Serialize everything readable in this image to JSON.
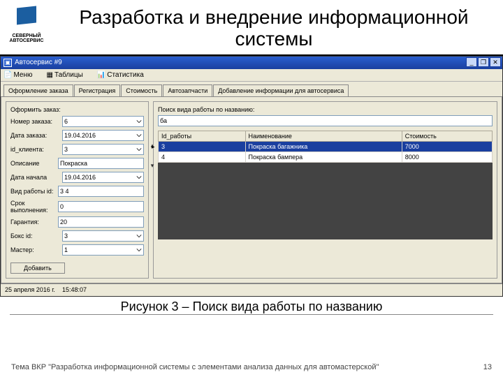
{
  "slide": {
    "title": "Разработка и внедрение информационной системы",
    "logo_caption": "СЕВЕРНЫЙ АВТОСЕРВИС"
  },
  "window": {
    "title": "Автосервис #9",
    "minimize": "_",
    "restore": "❐",
    "close": "✕"
  },
  "menu": {
    "items": [
      "Меню",
      "Таблицы",
      "Статистика"
    ]
  },
  "tabs": {
    "items": [
      "Оформление заказа",
      "Регистрация",
      "Стоимость",
      "Автозапчасти",
      "Добавление информации для автосервиса"
    ],
    "active_index": 0
  },
  "form": {
    "legend": "Оформить заказ:",
    "rows": [
      {
        "label": "Номер заказа:",
        "value": "6",
        "type": "select"
      },
      {
        "label": "Дата заказа:",
        "value": "19.04.2016",
        "type": "select"
      },
      {
        "label": "id_клиента:",
        "value": "3",
        "type": "select"
      },
      {
        "label": "Описание",
        "value": "Покраска",
        "type": "text"
      },
      {
        "label": "Дата начала",
        "value": "19.04.2016",
        "type": "select"
      },
      {
        "label": "Вид работы id:",
        "value": "3 4",
        "type": "text"
      },
      {
        "label": "Срок выполнения:",
        "value": "0",
        "type": "text"
      },
      {
        "label": "Гарантия:",
        "value": "20",
        "type": "text"
      },
      {
        "label": "Бокс id:",
        "value": "3",
        "type": "select"
      },
      {
        "label": "Мастер:",
        "value": "1",
        "type": "select"
      }
    ],
    "add_button": "Добавить"
  },
  "search": {
    "legend": "Поиск вида работы по названию:",
    "value": "ба"
  },
  "grid": {
    "headers": [
      "Id_работы",
      "Наименование",
      "Стоимость"
    ],
    "rows": [
      {
        "cells": [
          "3",
          "Покраска багажника",
          "7000"
        ],
        "selected": true
      },
      {
        "cells": [
          "4",
          "Покраска бампера",
          "8000"
        ],
        "selected": false
      }
    ],
    "nav": [
      "▴",
      "▾"
    ]
  },
  "status": {
    "date": "25 апреля 2016 г.",
    "time": "15:48:07"
  },
  "caption": "Рисунок 3 – Поиск вида работы по названию",
  "footer": {
    "text": "Тема ВКР \"Разработка информационной системы с элементами анализа данных для автомастерской\"",
    "page": "13"
  }
}
